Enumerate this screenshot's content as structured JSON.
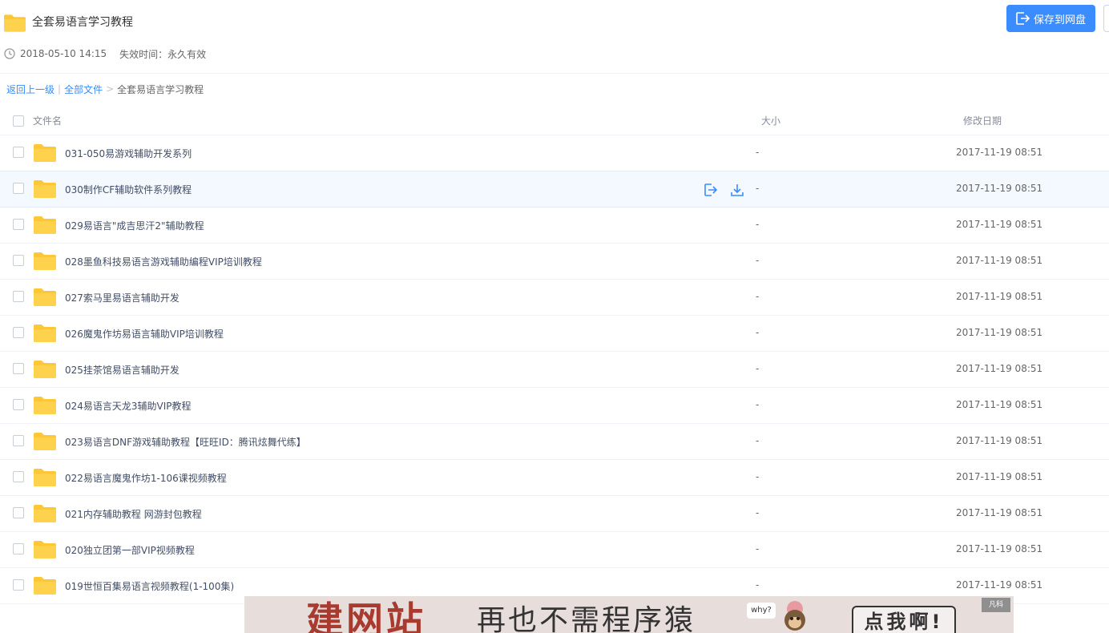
{
  "header": {
    "title": "全套易语言学习教程",
    "share_date": "2018-05-10 14:15",
    "expire": "失效时间：永久有效",
    "save_label": "保存到网盘"
  },
  "breadcrumb": {
    "back": "返回上一级",
    "sep1": "|",
    "all": "全部文件",
    "sep2": ">",
    "current": "全套易语言学习教程"
  },
  "columns": {
    "name": "文件名",
    "size": "大小",
    "date": "修改日期"
  },
  "rows": [
    {
      "name": "031-050易游戏辅助开发系列",
      "size": "-",
      "date": "2017-11-19 08:51"
    },
    {
      "name": "030制作CF辅助软件系列教程",
      "size": "-",
      "date": "2017-11-19 08:51"
    },
    {
      "name": "029易语言\"成吉思汗2\"辅助教程",
      "size": "-",
      "date": "2017-11-19 08:51"
    },
    {
      "name": "028墨鱼科技易语言游戏辅助编程VIP培训教程",
      "size": "-",
      "date": "2017-11-19 08:51"
    },
    {
      "name": "027索马里易语言辅助开发",
      "size": "-",
      "date": "2017-11-19 08:51"
    },
    {
      "name": "026魔鬼作坊易语言辅助VIP培训教程",
      "size": "-",
      "date": "2017-11-19 08:51"
    },
    {
      "name": "025挂茶馆易语言辅助开发",
      "size": "-",
      "date": "2017-11-19 08:51"
    },
    {
      "name": "024易语言天龙3辅助VIP教程",
      "size": "-",
      "date": "2017-11-19 08:51"
    },
    {
      "name": "023易语言DNF游戏辅助教程【旺旺ID：腾讯炫舞代练】",
      "size": "-",
      "date": "2017-11-19 08:51"
    },
    {
      "name": "022易语言魔鬼作坊1-106课视频教程",
      "size": "-",
      "date": "2017-11-19 08:51"
    },
    {
      "name": "021内存辅助教程 网游封包教程",
      "size": "-",
      "date": "2017-11-19 08:51"
    },
    {
      "name": "020独立团第一部VIP视频教程",
      "size": "-",
      "date": "2017-11-19 08:51"
    },
    {
      "name": "019世恒百集易语言视频教程(1-100集)",
      "size": "-",
      "date": "2017-11-19 08:51"
    }
  ],
  "banner": {
    "headline": "建网站",
    "subline": "再也不需程序猿",
    "bubble": "why?",
    "cta": "点我啊!",
    "logo": "凡科"
  },
  "colors": {
    "accent": "#3b8cff",
    "folder": "#ffd24d",
    "text": "#424e67"
  },
  "icons": [
    "folder-icon",
    "clock-icon",
    "save-icon",
    "share-icon",
    "download-icon",
    "checkbox"
  ]
}
